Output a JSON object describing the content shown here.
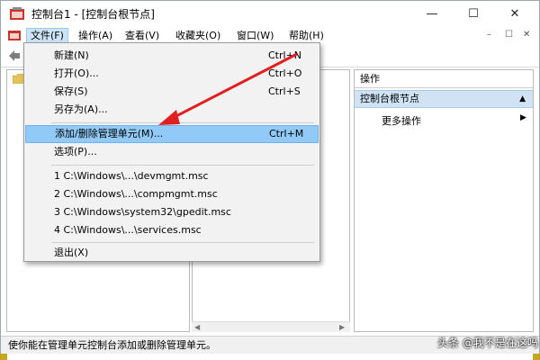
{
  "window": {
    "title": "控制台1 - [控制台根节点]",
    "minimize": "—",
    "maximize": "☐",
    "close": "✕"
  },
  "menubar": {
    "items": [
      "文件(F)",
      "操作(A)",
      "查看(V)",
      "收藏夹(O)",
      "窗口(W)",
      "帮助(H)"
    ],
    "mdi_controls": [
      "–",
      "☐",
      "✕"
    ]
  },
  "file_menu": {
    "items": [
      {
        "label": "新建(N)",
        "shortcut": "Ctrl+N"
      },
      {
        "label": "打开(O)...",
        "shortcut": "Ctrl+O"
      },
      {
        "label": "保存(S)",
        "shortcut": "Ctrl+S"
      },
      {
        "label": "另存为(A)...",
        "shortcut": ""
      },
      {
        "label": "添加/删除管理单元(M)...",
        "shortcut": "Ctrl+M"
      },
      {
        "label": "选项(P)...",
        "shortcut": ""
      },
      {
        "label": "1 C:\\Windows\\...\\devmgmt.msc",
        "shortcut": ""
      },
      {
        "label": "2 C:\\Windows\\...\\compmgmt.msc",
        "shortcut": ""
      },
      {
        "label": "3 C:\\Windows\\system32\\gpedit.msc",
        "shortcut": ""
      },
      {
        "label": "4 C:\\Windows\\...\\services.msc",
        "shortcut": ""
      },
      {
        "label": "退出(X)",
        "shortcut": ""
      }
    ],
    "highlighted_index": 4
  },
  "actions_pane": {
    "header": "操作",
    "section": "控制台根节点",
    "section_arrow": "▲",
    "more": "更多操作",
    "more_arrow": "▶"
  },
  "hscroll": {
    "left_arrow": "◀",
    "right_arrow": "▶"
  },
  "statusbar": {
    "text": "使你能在管理单元控制台添加或删除管理单元。"
  },
  "watermark": "头条 @我不是在这吗",
  "icons": [
    "app-icon",
    "menu-icon",
    "back-arrow-icon",
    "folder-icon"
  ],
  "colors": {
    "highlight": "#91c9f7",
    "section_bg": "#cfe3f5",
    "arrow": "#e02020"
  }
}
